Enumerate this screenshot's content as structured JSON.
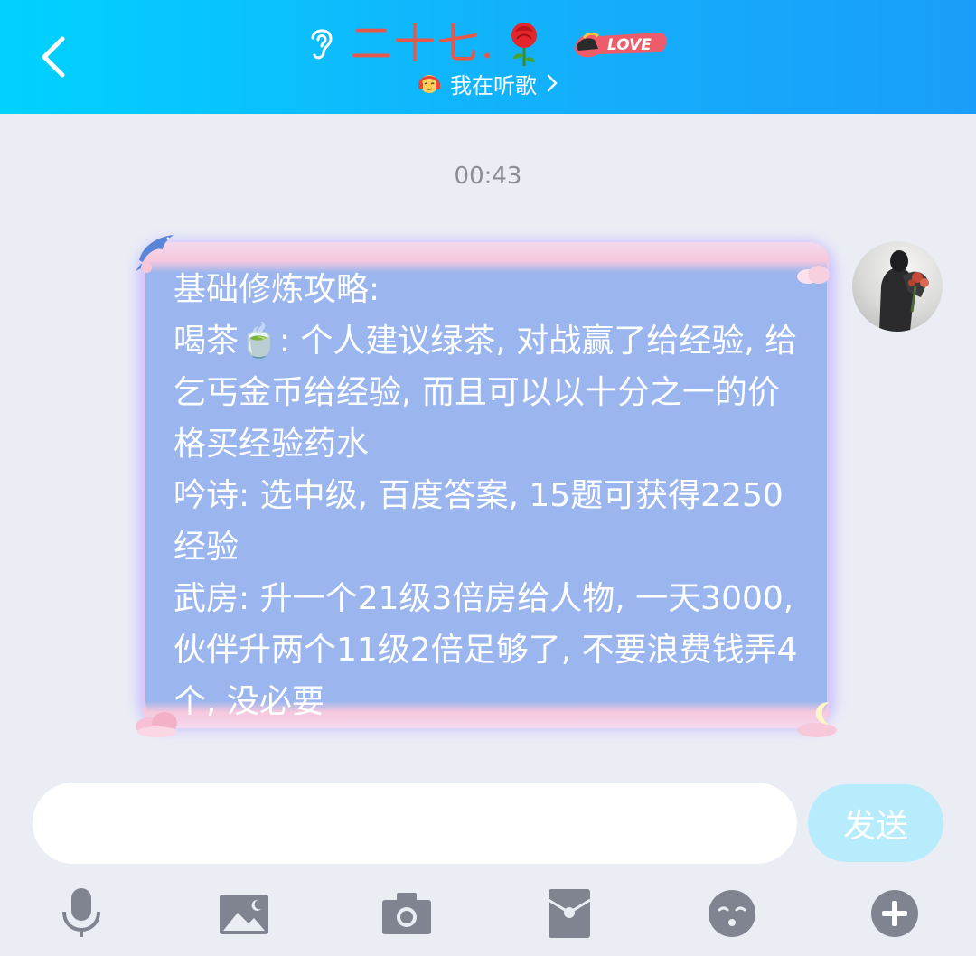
{
  "header": {
    "contact_name": "二十七.",
    "love_badge": "LOVE",
    "status_text": "我在听歌",
    "colors": {
      "gradient_start": "#00d2ff",
      "gradient_end": "#1a9dfa",
      "name_color": "#e7584a"
    }
  },
  "icons": {
    "back": "chevron-left-icon",
    "ear": "ear-icon",
    "rose": "rose-icon",
    "status": "headphones-emoji-icon"
  },
  "chat": {
    "timestamp": "00:43",
    "message": {
      "lines": [
        "基础修炼攻略:",
        "喝茶🍵: 个人建议绿茶, 对战赢了给经验, 给乞丐金币给经验, 而且可以以十分之一的价格买经验药水",
        "吟诗: 选中级, 百度答案, 15题可获得2250经验",
        "武房: 升一个21级3倍房给人物, 一天3000, 伙伴升两个11级2倍足够了, 不要浪费钱弄4个, 没必要"
      ]
    }
  },
  "input": {
    "placeholder": "",
    "value": "",
    "send_label": "发送"
  },
  "toolbar": {
    "items": [
      "microphone-icon",
      "image-icon",
      "camera-icon",
      "red-packet-icon",
      "emoji-icon",
      "plus-icon"
    ]
  }
}
